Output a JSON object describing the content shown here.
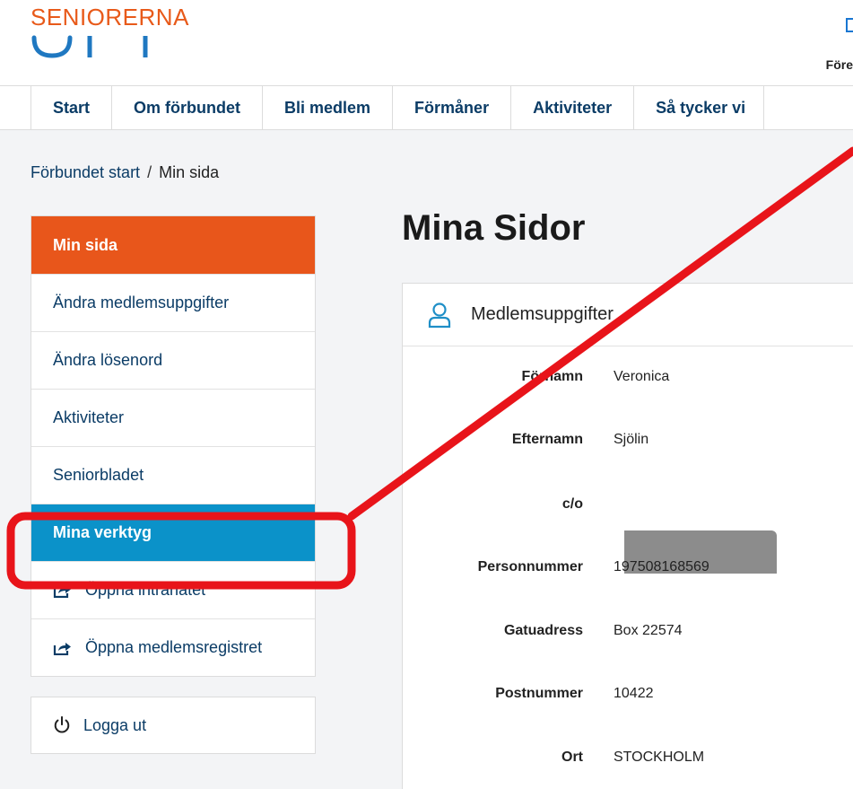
{
  "header": {
    "logo_text": "SENIORERNA",
    "right_text": "Före"
  },
  "nav": {
    "items": [
      {
        "label": "Start"
      },
      {
        "label": "Om förbundet"
      },
      {
        "label": "Bli medlem"
      },
      {
        "label": "Förmåner"
      },
      {
        "label": "Aktiviteter"
      },
      {
        "label": "Så tycker vi"
      }
    ]
  },
  "breadcrumb": {
    "home": "Förbundet start",
    "separator": "/",
    "current": "Min sida"
  },
  "sidebar": {
    "items": [
      {
        "label": "Min sida"
      },
      {
        "label": "Ändra medlemsuppgifter"
      },
      {
        "label": "Ändra lösenord"
      },
      {
        "label": "Aktiviteter"
      },
      {
        "label": "Seniorbladet"
      },
      {
        "label": "Mina verktyg"
      },
      {
        "label": "Öppna intranätet"
      },
      {
        "label": "Öppna medlemsregistret"
      }
    ],
    "logout": "Logga ut"
  },
  "main": {
    "title": "Mina Sidor",
    "card_title": "Medlemsuppgifter",
    "fields": [
      {
        "label": "Förnamn",
        "value": "Veronica"
      },
      {
        "label": "Efternamn",
        "value": "Sjölin"
      },
      {
        "label": "c/o",
        "value": ""
      },
      {
        "label": "Personnummer",
        "value": "197508168569"
      },
      {
        "label": "Gatuadress",
        "value": "Box 22574"
      },
      {
        "label": "Postnummer",
        "value": "10422"
      },
      {
        "label": "Ort",
        "value": "STOCKHOLM"
      }
    ]
  },
  "colors": {
    "brand_orange": "#e8561b",
    "active_blue": "#0b92c9",
    "nav_text": "#0b3c66",
    "annotation_red": "#e8141a"
  }
}
